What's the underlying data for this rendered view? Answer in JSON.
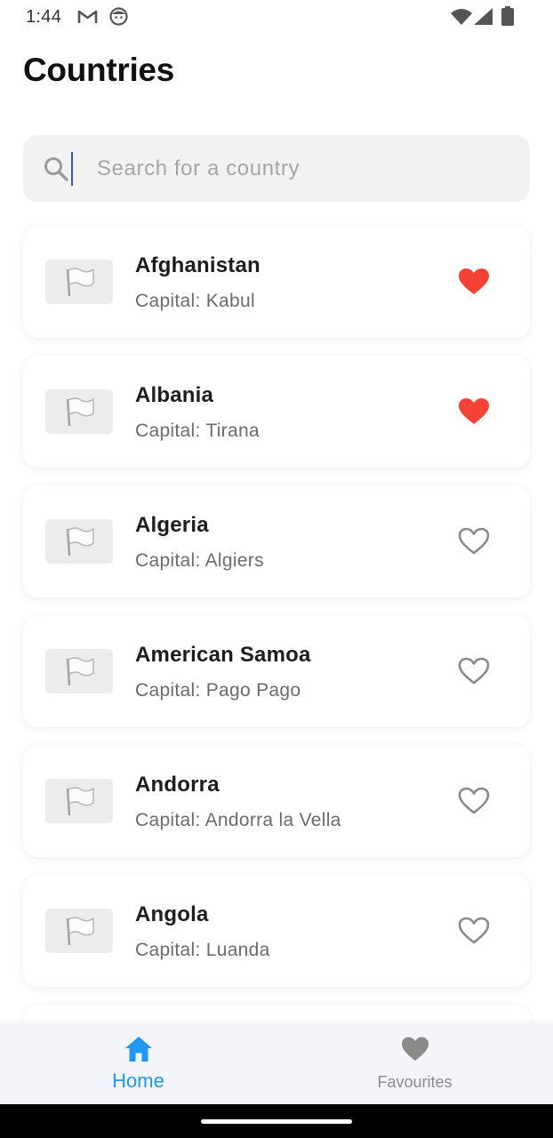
{
  "status_bar": {
    "time": "1:44",
    "icons": [
      "gmail-icon",
      "face-icon",
      "wifi-icon",
      "signal-icon",
      "battery-icon"
    ]
  },
  "page": {
    "title": "Countries"
  },
  "search": {
    "placeholder": "Search for a country",
    "value": "",
    "icon": "search-icon"
  },
  "countries": [
    {
      "name": "Afghanistan",
      "capital": "Capital: Kabul",
      "favourite": true
    },
    {
      "name": "Albania",
      "capital": "Capital: Tirana",
      "favourite": true
    },
    {
      "name": "Algeria",
      "capital": "Capital: Algiers",
      "favourite": false
    },
    {
      "name": "American Samoa",
      "capital": "Capital: Pago Pago",
      "favourite": false
    },
    {
      "name": "Andorra",
      "capital": "Capital: Andorra la Vella",
      "favourite": false
    },
    {
      "name": "Angola",
      "capital": "Capital: Luanda",
      "favourite": false
    }
  ],
  "bottom_nav": {
    "items": [
      {
        "label": "Home",
        "icon": "home-icon",
        "active": true
      },
      {
        "label": "Favourites",
        "icon": "heart-icon",
        "active": false
      }
    ]
  },
  "colors": {
    "accent": "#2196f3",
    "favourite": "#f44336",
    "inactive_icon": "#8a8a8a",
    "card_background": "#ffffff",
    "search_background": "#f2f2f2",
    "nav_background": "#f3f5fa"
  }
}
